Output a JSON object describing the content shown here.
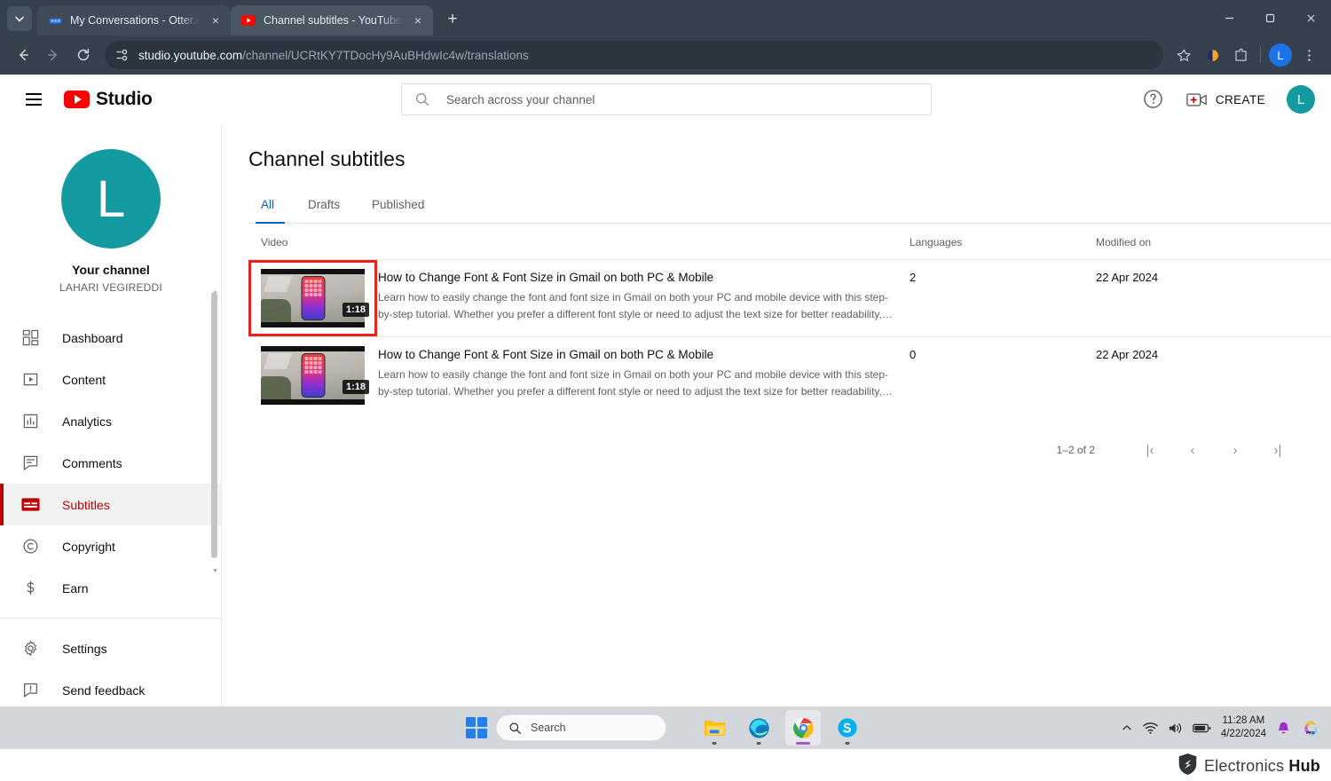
{
  "browser": {
    "tabs": [
      {
        "title": "My Conversations - Otter.ai",
        "favicon": "otter-icon",
        "active": false
      },
      {
        "title": "Channel subtitles - YouTube St",
        "favicon": "youtube-icon",
        "active": true
      }
    ],
    "new_tab_label": "+",
    "close_label": "×",
    "nav": {
      "back": "←",
      "forward": "→",
      "reload": "↻"
    },
    "url_prefix": "studio.youtube.com",
    "url_suffix": "/channel/UCRtKY7TDocHy9AuBHdwIc4w/translations",
    "icons": [
      "site-settings-icon",
      "bookmark-star-icon",
      "extension-profile-icon",
      "extensions-puzzle-icon",
      "browser-menu-icon"
    ],
    "profile_initial": "L",
    "window_controls": {
      "minimize": "—",
      "maximize": "❐",
      "close": "✕"
    }
  },
  "studio": {
    "brand": "Studio",
    "search": {
      "placeholder": "Search across your channel",
      "value": ""
    },
    "create_label": "CREATE",
    "avatar_initial": "L",
    "help_icon": "help-circle-icon"
  },
  "sidebar": {
    "channel_label": "Your channel",
    "channel_name": "LAHARI VEGIREDDI",
    "avatar_initial": "L",
    "items": [
      {
        "label": "Dashboard",
        "icon": "dashboard-icon",
        "active": false
      },
      {
        "label": "Content",
        "icon": "content-icon",
        "active": false
      },
      {
        "label": "Analytics",
        "icon": "analytics-icon",
        "active": false
      },
      {
        "label": "Comments",
        "icon": "comments-icon",
        "active": false
      },
      {
        "label": "Subtitles",
        "icon": "subtitles-icon",
        "active": true
      },
      {
        "label": "Copyright",
        "icon": "copyright-icon",
        "active": false
      },
      {
        "label": "Earn",
        "icon": "earn-dollar-icon",
        "active": false
      }
    ],
    "footer_items": [
      {
        "label": "Settings",
        "icon": "gear-icon"
      },
      {
        "label": "Send feedback",
        "icon": "feedback-icon"
      }
    ]
  },
  "main": {
    "page_title": "Channel subtitles",
    "tabs": [
      {
        "label": "All",
        "selected": true
      },
      {
        "label": "Drafts",
        "selected": false
      },
      {
        "label": "Published",
        "selected": false
      }
    ],
    "columns": {
      "video": "Video",
      "languages": "Languages",
      "modified": "Modified on"
    },
    "rows": [
      {
        "title": "How to Change Font & Font Size in Gmail on both PC & Mobile",
        "description": "Learn how to easily change the font and font size in Gmail on both your PC and mobile device with this step-by-step tutorial. Whether you prefer a different font style or need to adjust the text size for better readability,…",
        "duration": "1:18",
        "languages": "2",
        "modified": "22 Apr 2024",
        "highlighted": true
      },
      {
        "title": "How to Change Font & Font Size in Gmail on both PC & Mobile",
        "description": "Learn how to easily change the font and font size in Gmail on both your PC and mobile device with this step-by-step tutorial. Whether you prefer a different font style or need to adjust the text size for better readability,…",
        "duration": "1:18",
        "languages": "0",
        "modified": "22 Apr 2024",
        "highlighted": false
      }
    ],
    "pagination": {
      "label": "1–2 of 2",
      "first": "|‹",
      "prev": "‹",
      "next": "›",
      "last": "›|"
    }
  },
  "taskbar": {
    "search_placeholder": "Search",
    "apps": [
      "file-explorer-icon",
      "microsoft-edge-icon",
      "google-chrome-icon",
      "skype-icon"
    ],
    "tray": [
      "chevron-up-icon",
      "wifi-icon",
      "volume-icon",
      "battery-icon"
    ],
    "time": "11:28 AM",
    "date": "4/22/2024",
    "notification_icon": "bell-icon",
    "extra_icon": "copilot-icon"
  },
  "watermark": {
    "brand_light": "Electronics ",
    "brand_bold": "Hub"
  },
  "colors": {
    "accent_red": "#c00000",
    "accent_blue": "#065fd4",
    "avatar_teal": "#149ba1",
    "highlight_red": "#e8241a"
  }
}
